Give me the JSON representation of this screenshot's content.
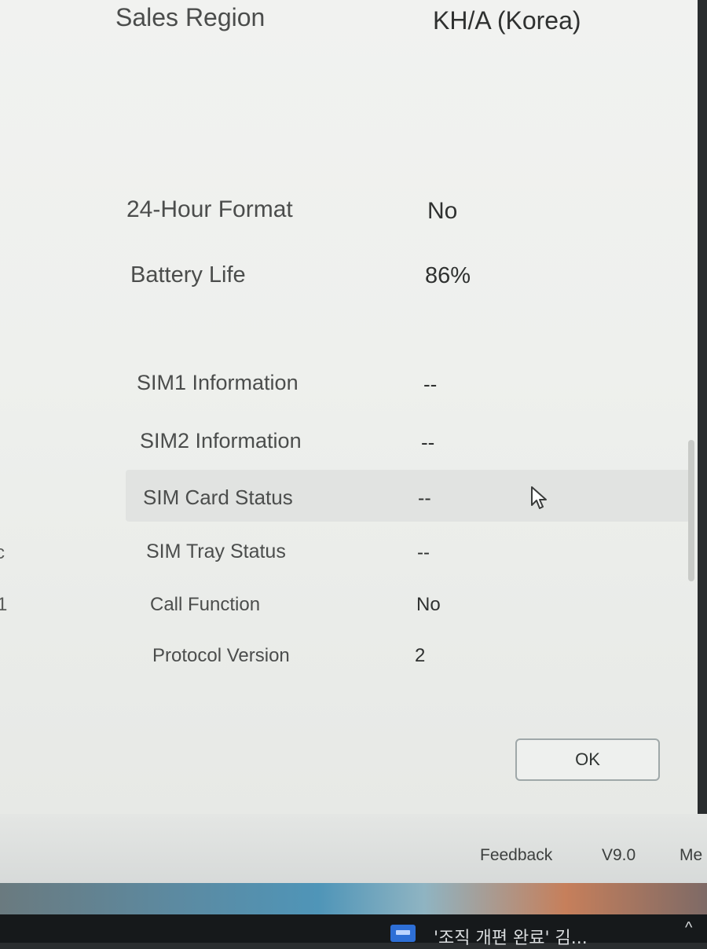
{
  "info_rows": [
    {
      "label": "Sales Region",
      "value": "KH/A (Korea)"
    },
    {
      "label": "24-Hour Format",
      "value": "No"
    },
    {
      "label": "Battery Life",
      "value": "86%"
    },
    {
      "label": "SIM1 Information",
      "value": "--"
    },
    {
      "label": "SIM2 Information",
      "value": "--"
    },
    {
      "label": "SIM Card Status",
      "value": "--"
    },
    {
      "label": "SIM Tray Status",
      "value": "--"
    },
    {
      "label": "Call Function",
      "value": "No"
    },
    {
      "label": "Protocol Version",
      "value": "2"
    }
  ],
  "dialog": {
    "ok_label": "OK"
  },
  "footer": {
    "feedback_label": "Feedback",
    "version_label": "V9.0",
    "menu_label": "Me"
  },
  "taskbar": {
    "notification_text": "'조직 개편 완료' 김...",
    "tray_chevron": "^"
  },
  "left_edge_glyphs": [
    "c",
    "1"
  ],
  "colors": {
    "selected_row": "#e1e3e1",
    "dialog_background": "#f0f1ef",
    "taskbar": "#16191b"
  },
  "icons": {
    "cursor": "mouse-pointer-icon",
    "taskbar_app": "app-window-icon"
  }
}
